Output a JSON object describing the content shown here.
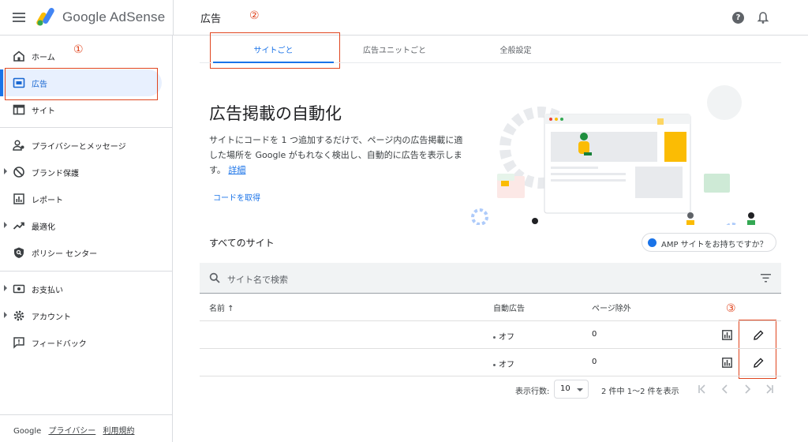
{
  "topbar": {
    "product_name": "Google AdSense",
    "page_title": "広告"
  },
  "sidebar": {
    "items": [
      {
        "label": "ホーム"
      },
      {
        "label": "広告"
      },
      {
        "label": "サイト"
      },
      {
        "label": "プライバシーとメッセージ"
      },
      {
        "label": "ブランド保護"
      },
      {
        "label": "レポート"
      },
      {
        "label": "最適化"
      },
      {
        "label": "ポリシー センター"
      },
      {
        "label": "お支払い"
      },
      {
        "label": "アカウント"
      },
      {
        "label": "フィードバック"
      }
    ],
    "footer": {
      "brand": "Google",
      "privacy": "プライバシー",
      "terms": "利用規約"
    }
  },
  "annotations": {
    "n1": "①",
    "n2": "②",
    "n3": "③"
  },
  "tabs": [
    {
      "label": "サイトごと"
    },
    {
      "label": "広告ユニットごと"
    },
    {
      "label": "全般設定"
    }
  ],
  "hero": {
    "title": "広告掲載の自動化",
    "description": "サイトにコードを 1 つ追加するだけで、ページ内の広告掲載に適した場所を Google がもれなく検出し、自動的に広告を表示します。",
    "details_link": "詳細",
    "get_code": "コードを取得"
  },
  "sites": {
    "title": "すべてのサイト",
    "amp_button": "AMP サイトをお持ちですか？",
    "search_placeholder": "サイト名で検索",
    "columns": {
      "name": "名前 ↑",
      "auto_ads": "自動広告",
      "page_exclusions": "ページ除外"
    },
    "rows": [
      {
        "name": "",
        "auto_ads": "オフ",
        "page_exclusions": "0"
      },
      {
        "name": "",
        "auto_ads": "オフ",
        "page_exclusions": "0"
      }
    ]
  },
  "pagination": {
    "rows_label": "表示行数:",
    "rows_value": "10",
    "range_text": "2 件中 1〜2 件を表示"
  },
  "colors": {
    "accent": "#1a73e8",
    "annotation": "#e0451f",
    "active_bg": "#e8f0fe"
  }
}
